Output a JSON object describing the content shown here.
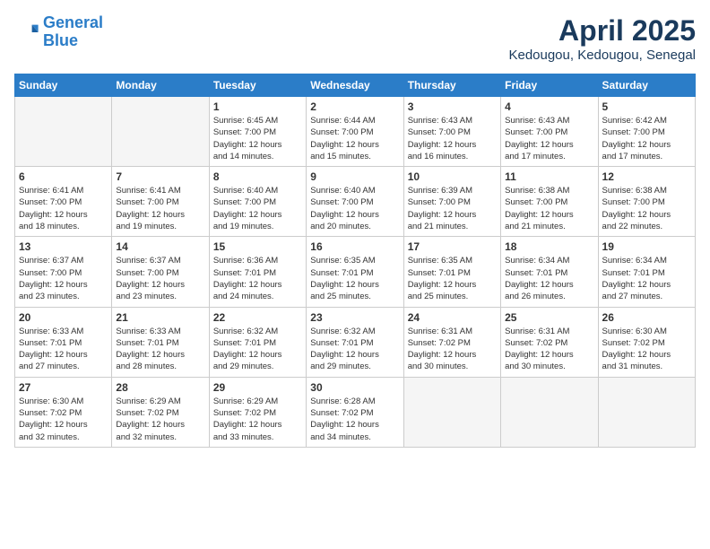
{
  "header": {
    "logo_line1": "General",
    "logo_line2": "Blue",
    "month": "April 2025",
    "location": "Kedougou, Kedougou, Senegal"
  },
  "weekdays": [
    "Sunday",
    "Monday",
    "Tuesday",
    "Wednesday",
    "Thursday",
    "Friday",
    "Saturday"
  ],
  "weeks": [
    [
      {
        "day": "",
        "info": ""
      },
      {
        "day": "",
        "info": ""
      },
      {
        "day": "1",
        "info": "Sunrise: 6:45 AM\nSunset: 7:00 PM\nDaylight: 12 hours\nand 14 minutes."
      },
      {
        "day": "2",
        "info": "Sunrise: 6:44 AM\nSunset: 7:00 PM\nDaylight: 12 hours\nand 15 minutes."
      },
      {
        "day": "3",
        "info": "Sunrise: 6:43 AM\nSunset: 7:00 PM\nDaylight: 12 hours\nand 16 minutes."
      },
      {
        "day": "4",
        "info": "Sunrise: 6:43 AM\nSunset: 7:00 PM\nDaylight: 12 hours\nand 17 minutes."
      },
      {
        "day": "5",
        "info": "Sunrise: 6:42 AM\nSunset: 7:00 PM\nDaylight: 12 hours\nand 17 minutes."
      }
    ],
    [
      {
        "day": "6",
        "info": "Sunrise: 6:41 AM\nSunset: 7:00 PM\nDaylight: 12 hours\nand 18 minutes."
      },
      {
        "day": "7",
        "info": "Sunrise: 6:41 AM\nSunset: 7:00 PM\nDaylight: 12 hours\nand 19 minutes."
      },
      {
        "day": "8",
        "info": "Sunrise: 6:40 AM\nSunset: 7:00 PM\nDaylight: 12 hours\nand 19 minutes."
      },
      {
        "day": "9",
        "info": "Sunrise: 6:40 AM\nSunset: 7:00 PM\nDaylight: 12 hours\nand 20 minutes."
      },
      {
        "day": "10",
        "info": "Sunrise: 6:39 AM\nSunset: 7:00 PM\nDaylight: 12 hours\nand 21 minutes."
      },
      {
        "day": "11",
        "info": "Sunrise: 6:38 AM\nSunset: 7:00 PM\nDaylight: 12 hours\nand 21 minutes."
      },
      {
        "day": "12",
        "info": "Sunrise: 6:38 AM\nSunset: 7:00 PM\nDaylight: 12 hours\nand 22 minutes."
      }
    ],
    [
      {
        "day": "13",
        "info": "Sunrise: 6:37 AM\nSunset: 7:00 PM\nDaylight: 12 hours\nand 23 minutes."
      },
      {
        "day": "14",
        "info": "Sunrise: 6:37 AM\nSunset: 7:00 PM\nDaylight: 12 hours\nand 23 minutes."
      },
      {
        "day": "15",
        "info": "Sunrise: 6:36 AM\nSunset: 7:01 PM\nDaylight: 12 hours\nand 24 minutes."
      },
      {
        "day": "16",
        "info": "Sunrise: 6:35 AM\nSunset: 7:01 PM\nDaylight: 12 hours\nand 25 minutes."
      },
      {
        "day": "17",
        "info": "Sunrise: 6:35 AM\nSunset: 7:01 PM\nDaylight: 12 hours\nand 25 minutes."
      },
      {
        "day": "18",
        "info": "Sunrise: 6:34 AM\nSunset: 7:01 PM\nDaylight: 12 hours\nand 26 minutes."
      },
      {
        "day": "19",
        "info": "Sunrise: 6:34 AM\nSunset: 7:01 PM\nDaylight: 12 hours\nand 27 minutes."
      }
    ],
    [
      {
        "day": "20",
        "info": "Sunrise: 6:33 AM\nSunset: 7:01 PM\nDaylight: 12 hours\nand 27 minutes."
      },
      {
        "day": "21",
        "info": "Sunrise: 6:33 AM\nSunset: 7:01 PM\nDaylight: 12 hours\nand 28 minutes."
      },
      {
        "day": "22",
        "info": "Sunrise: 6:32 AM\nSunset: 7:01 PM\nDaylight: 12 hours\nand 29 minutes."
      },
      {
        "day": "23",
        "info": "Sunrise: 6:32 AM\nSunset: 7:01 PM\nDaylight: 12 hours\nand 29 minutes."
      },
      {
        "day": "24",
        "info": "Sunrise: 6:31 AM\nSunset: 7:02 PM\nDaylight: 12 hours\nand 30 minutes."
      },
      {
        "day": "25",
        "info": "Sunrise: 6:31 AM\nSunset: 7:02 PM\nDaylight: 12 hours\nand 30 minutes."
      },
      {
        "day": "26",
        "info": "Sunrise: 6:30 AM\nSunset: 7:02 PM\nDaylight: 12 hours\nand 31 minutes."
      }
    ],
    [
      {
        "day": "27",
        "info": "Sunrise: 6:30 AM\nSunset: 7:02 PM\nDaylight: 12 hours\nand 32 minutes."
      },
      {
        "day": "28",
        "info": "Sunrise: 6:29 AM\nSunset: 7:02 PM\nDaylight: 12 hours\nand 32 minutes."
      },
      {
        "day": "29",
        "info": "Sunrise: 6:29 AM\nSunset: 7:02 PM\nDaylight: 12 hours\nand 33 minutes."
      },
      {
        "day": "30",
        "info": "Sunrise: 6:28 AM\nSunset: 7:02 PM\nDaylight: 12 hours\nand 34 minutes."
      },
      {
        "day": "",
        "info": ""
      },
      {
        "day": "",
        "info": ""
      },
      {
        "day": "",
        "info": ""
      }
    ]
  ]
}
